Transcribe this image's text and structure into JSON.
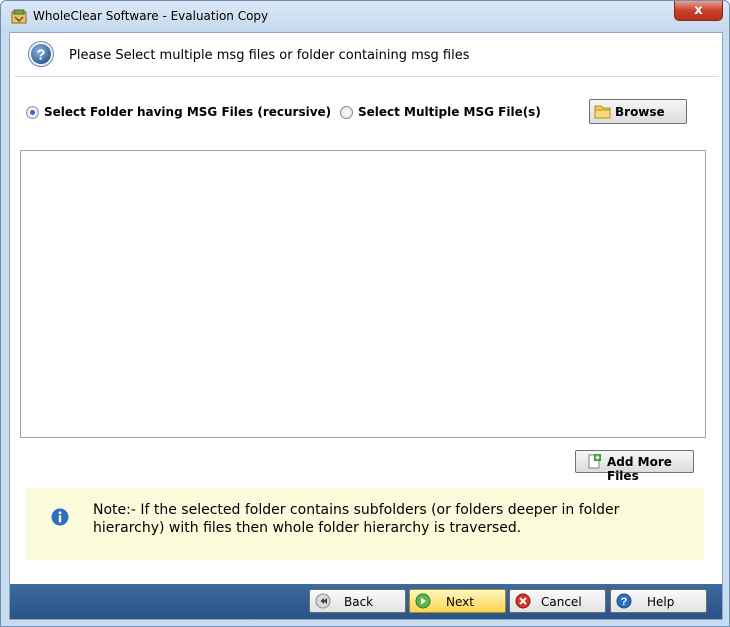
{
  "window": {
    "title": "WholeClear Software - Evaluation Copy",
    "close_glyph": "x"
  },
  "header": {
    "icon": "help-circle-icon",
    "text": "Please Select multiple msg files or folder containing msg files"
  },
  "options": {
    "folder_label": "Select Folder having MSG Files (recursive)",
    "folder_selected": true,
    "multiple_label": "Select Multiple MSG File(s)",
    "multiple_selected": false,
    "browse_label": "Browse"
  },
  "file_list": {
    "items": []
  },
  "add_more_label": "Add More Files",
  "note": {
    "icon": "info-icon",
    "text": "Note:- If the selected folder contains subfolders (or folders deeper in folder hierarchy) with files then whole folder hierarchy is traversed."
  },
  "footer": {
    "back_label": "Back",
    "next_label": "Next",
    "cancel_label": "Cancel",
    "help_label": "Help"
  },
  "colors": {
    "footer_bg": "#2a5488",
    "note_bg": "#fbfbdb",
    "next_button": "#fbd64c"
  }
}
